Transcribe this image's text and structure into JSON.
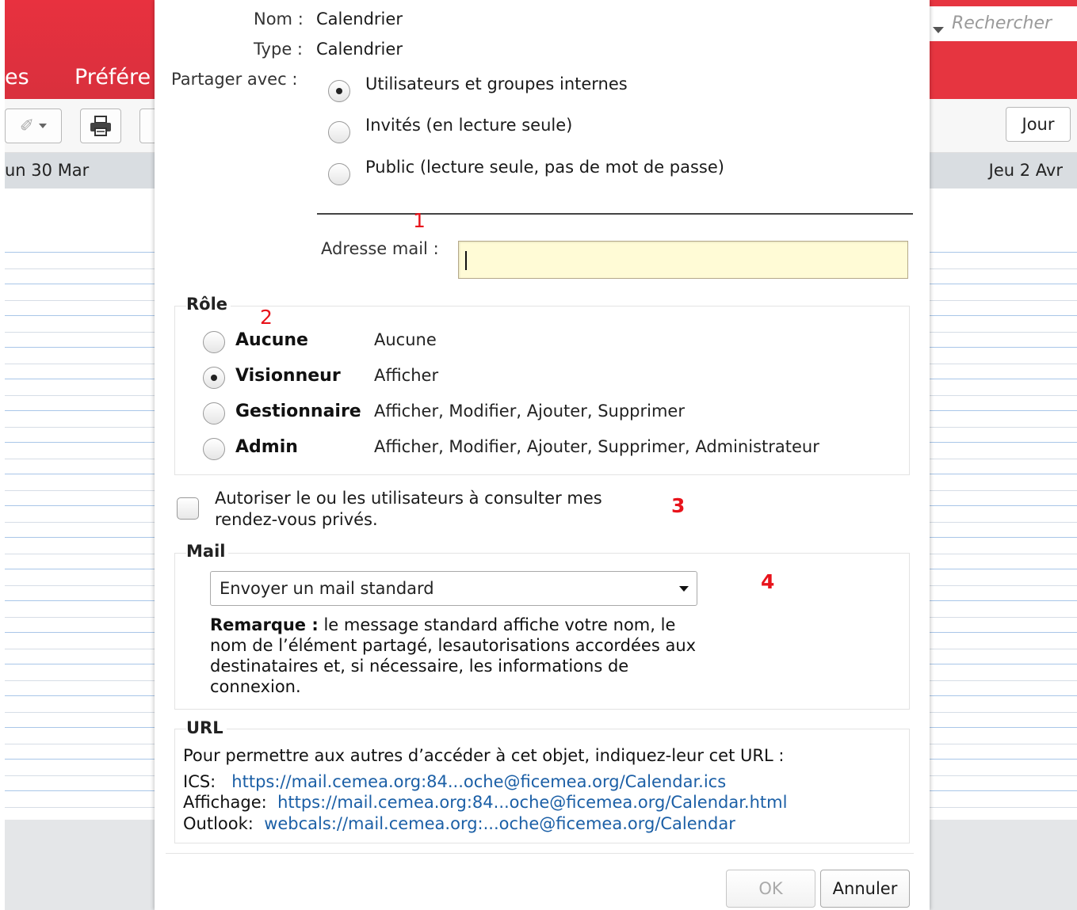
{
  "background": {
    "menu_tabs": [
      "es",
      "Préfére"
    ],
    "search_placeholder": "Rechercher",
    "day_left": "un 30 Mar",
    "day_right": "Jeu 2 Avr",
    "view_button": "Jour"
  },
  "dialog": {
    "fields": {
      "name_label": "Nom :",
      "name_value": "Calendrier",
      "type_label": "Type :",
      "type_value": "Calendrier",
      "share_label": "Partager avec :"
    },
    "share_options": [
      {
        "label": "Utilisateurs et groupes internes",
        "checked": true
      },
      {
        "label": "Invités (en lecture seule)",
        "checked": false
      },
      {
        "label": "Public (lecture seule, pas de mot de passe)",
        "checked": false
      }
    ],
    "email": {
      "label": "Adresse mail :",
      "value": ""
    },
    "role": {
      "legend": "Rôle",
      "options": [
        {
          "name": "Aucune",
          "description": "Aucune",
          "checked": false
        },
        {
          "name": "Visionneur",
          "description": "Afficher",
          "checked": true
        },
        {
          "name": "Gestionnaire",
          "description": "Afficher, Modifier, Ajouter, Supprimer",
          "checked": false
        },
        {
          "name": "Admin",
          "description": "Afficher, Modifier, Ajouter, Supprimer, Administrateur",
          "checked": false
        }
      ]
    },
    "private_checkbox": {
      "line1": "Autoriser le ou les utilisateurs à consulter mes",
      "line2": "rendez-vous privés.",
      "checked": false
    },
    "mail": {
      "legend": "Mail",
      "selected": "Envoyer un mail standard",
      "remark_bold": "Remarque :",
      "remark_line1": " le message standard affiche votre nom, le",
      "remark_line2": "nom de l’élément partagé, lesautorisations accordées aux",
      "remark_line3": "destinataires et, si nécessaire, les informations de",
      "remark_line4": "connexion."
    },
    "url": {
      "legend": "URL",
      "intro": "Pour permettre aux autres d’accéder à cet objet, indiquez-leur cet URL :",
      "ics_label": "ICS:",
      "ics_link": "https://mail.cemea.org:84...oche@ficemea.org/Calendar.ics",
      "html_label": "Affichage:",
      "html_link": "https://mail.cemea.org:84...oche@ficemea.org/Calendar.html",
      "outlook_label": "Outlook:",
      "outlook_link": "webcals://mail.cemea.org:...oche@ficemea.org/Calendar"
    },
    "buttons": {
      "ok": "OK",
      "cancel": "Annuler"
    }
  },
  "annotations": [
    "1",
    "2",
    "3",
    "4"
  ],
  "colors": {
    "brand_red": "#e63540",
    "link_blue": "#1b5fa6",
    "annotation_red": "#e8131b",
    "input_highlight": "#fffbd6"
  }
}
